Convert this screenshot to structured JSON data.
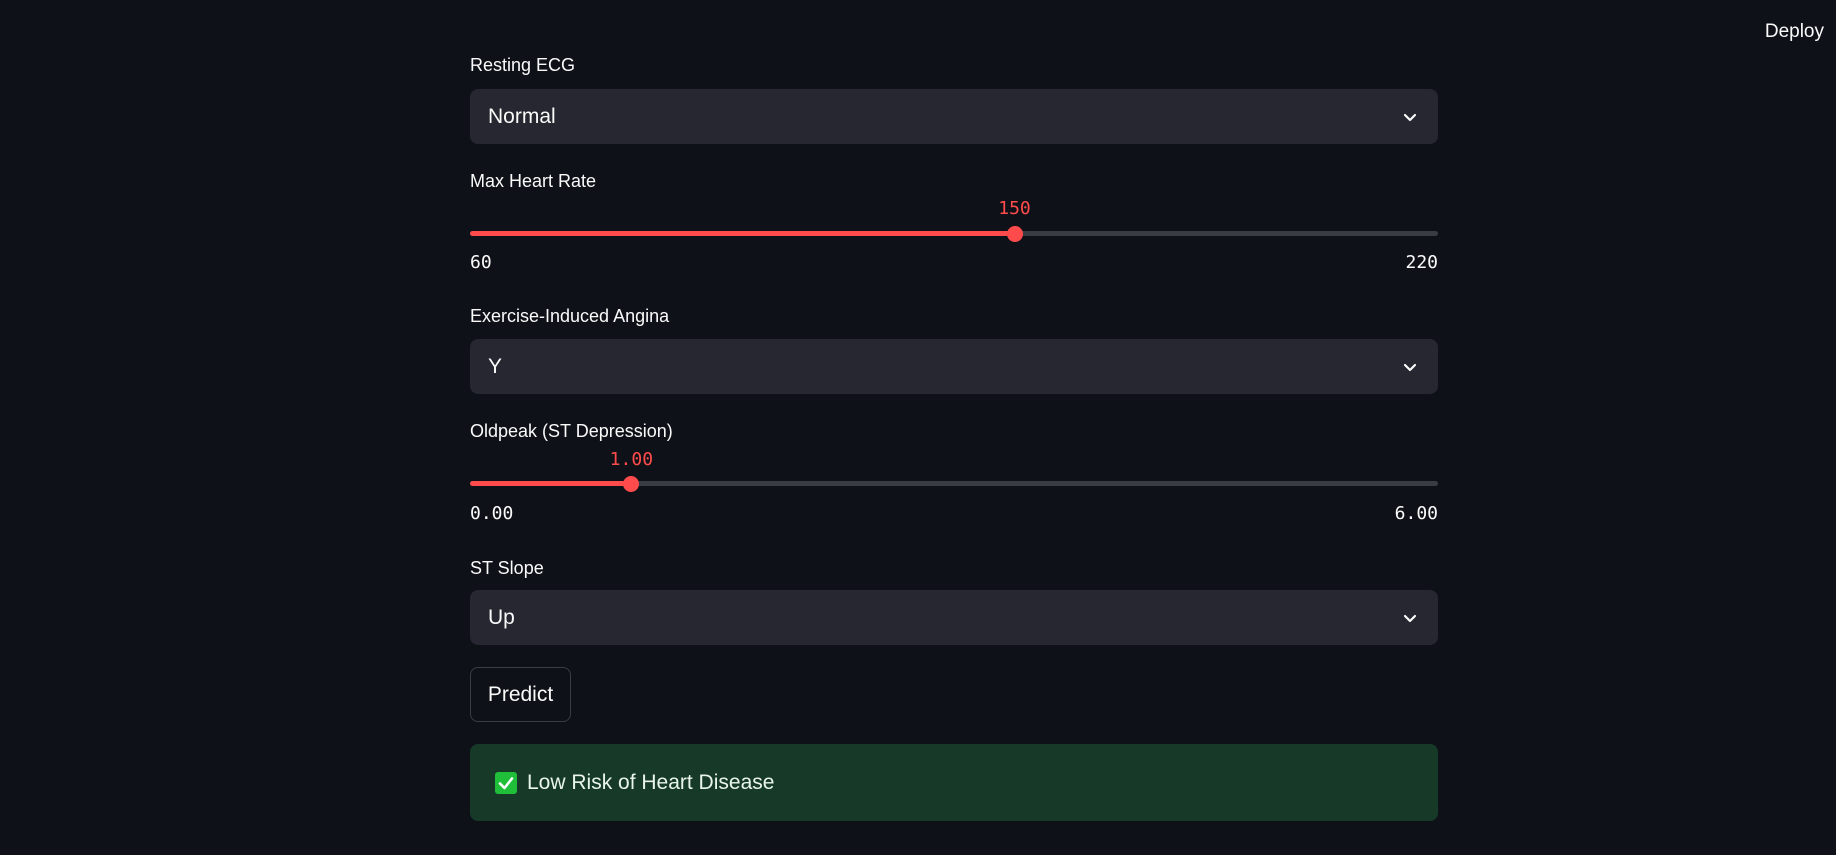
{
  "header": {
    "deploy_label": "Deploy"
  },
  "form": {
    "resting_ecg": {
      "label": "Resting ECG",
      "value": "Normal"
    },
    "max_heart_rate": {
      "label": "Max Heart Rate",
      "value": "150",
      "min": "60",
      "max": "220",
      "fraction": 0.5625
    },
    "exercise_angina": {
      "label": "Exercise-Induced Angina",
      "value": "Y"
    },
    "oldpeak": {
      "label": "Oldpeak (ST Depression)",
      "value": "1.00",
      "min": "0.00",
      "max": "6.00",
      "fraction": 0.1667
    },
    "st_slope": {
      "label": "ST Slope",
      "value": "Up"
    },
    "predict_label": "Predict"
  },
  "result": {
    "message": "Low Risk of Heart Disease",
    "icon": "check-mark-icon"
  },
  "colors": {
    "background": "#0e1117",
    "accent": "#ff4b4b",
    "select_bg": "#262730",
    "success_bg": "#173928",
    "check_green": "#1fbf3a"
  }
}
